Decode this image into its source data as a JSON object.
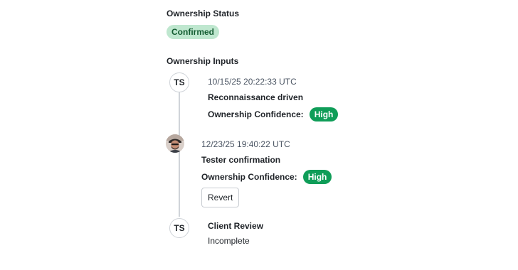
{
  "ownership_status": {
    "heading": "Ownership Status",
    "status": "Confirmed"
  },
  "ownership_inputs": {
    "heading": "Ownership Inputs",
    "entries": [
      {
        "avatar_initials": "TS",
        "timestamp": "10/15/25 20:22:33 UTC",
        "title": "Reconnaissance driven",
        "confidence_label": "Ownership Confidence:",
        "confidence_value": "High"
      },
      {
        "avatar_type": "photo",
        "timestamp": "12/23/25 19:40:22 UTC",
        "title": "Tester confirmation",
        "confidence_label": "Ownership Confidence:",
        "confidence_value": "High",
        "action_label": "Revert"
      },
      {
        "avatar_initials": "TS",
        "title": "Client Review",
        "status": "Incomplete"
      }
    ]
  },
  "colors": {
    "confirmed_bg": "#bfe7cf",
    "confirmed_text": "#135c31",
    "high_bg": "#0f9d58",
    "timeline_line": "#d0d4d9"
  }
}
